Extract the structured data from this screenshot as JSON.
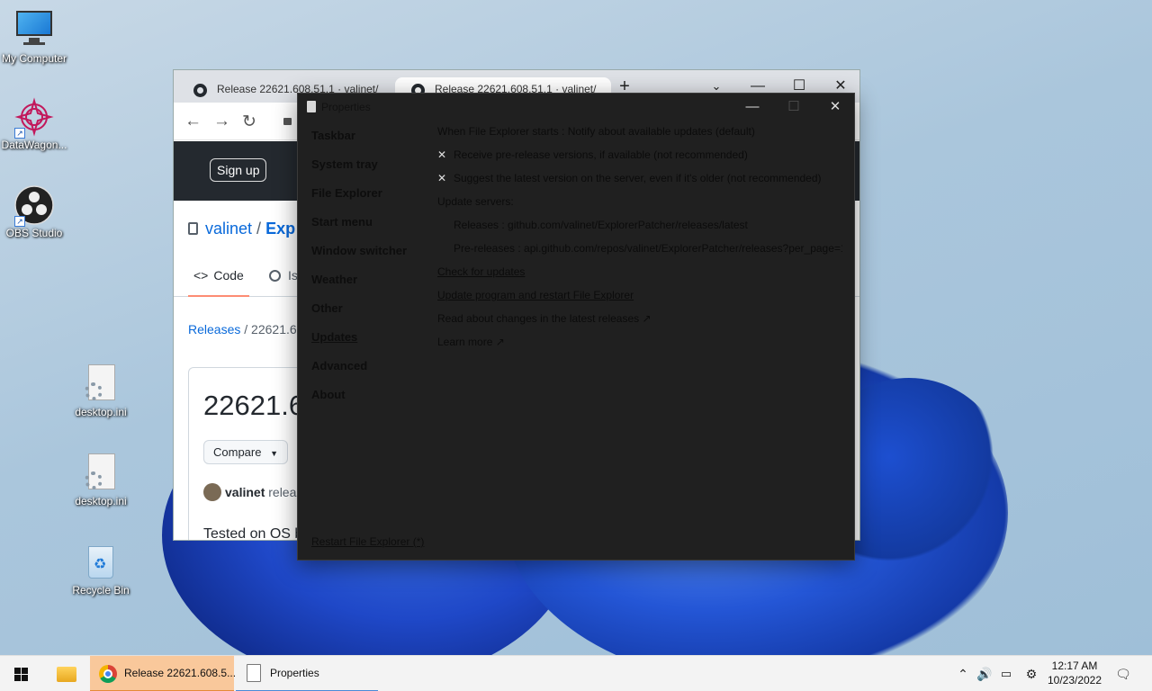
{
  "desktop": {
    "icons": [
      {
        "label": "My Computer"
      },
      {
        "label": "DataWagon..."
      },
      {
        "label": "OBS Studio"
      },
      {
        "label": "desktop.ini"
      },
      {
        "label": "desktop.ini"
      },
      {
        "label": "Recycle Bin"
      }
    ]
  },
  "browser": {
    "tabs": [
      {
        "title": "Release 22621.608.51.1 · valinet/"
      },
      {
        "title": "Release 22621.608.51.1 · valinet/"
      }
    ],
    "signup_label": "Sign up",
    "repo_owner": "valinet",
    "repo_sep": "/",
    "repo_name": "Exp",
    "code_tab": "Code",
    "issues_tab": "Is",
    "breadcrumb_releases": "Releases",
    "breadcrumb_sep": "/",
    "breadcrumb_current": "22621.60",
    "release_title": "22621.6",
    "compare_label": "Compare",
    "author": "valinet",
    "author_suffix": "releas",
    "tested_text": "Tested on OS b"
  },
  "properties": {
    "title": "Properties",
    "sidebar": [
      {
        "label": "Taskbar"
      },
      {
        "label": "System tray"
      },
      {
        "label": "File Explorer"
      },
      {
        "label": "Start menu"
      },
      {
        "label": "Window switcher"
      },
      {
        "label": "Weather"
      },
      {
        "label": "Other"
      },
      {
        "label": "Updates"
      },
      {
        "label": "Advanced"
      },
      {
        "label": "About"
      }
    ],
    "content": {
      "startup_line": "When File Explorer starts : Notify about available updates (default)",
      "prerelease_option": "Receive pre-release versions, if available (not recommended)",
      "latest_option": "Suggest the latest version on the server, even if it's older (not recommended)",
      "servers_heading": "Update servers:",
      "releases_server": "Releases : github.com/valinet/ExplorerPatcher/releases/latest",
      "prereleases_server": "Pre-releases : api.github.com/repos/valinet/ExplorerPatcher/releases?per_page=1",
      "check_link": "Check for updates",
      "update_link": "Update program and restart File Explorer",
      "changes_link": "Read about changes in the latest releases ↗",
      "learn_link": "Learn more ↗"
    },
    "restart_link": "Restart File Explorer (*)"
  },
  "taskbar": {
    "chrome_task": "Release 22621.608.5...",
    "props_task": "Properties",
    "time": "12:17 AM",
    "date": "10/23/2022"
  },
  "colors": {
    "accent_task": "#f9c89b",
    "github_header": "#24292f",
    "props_bg": "#202020"
  }
}
